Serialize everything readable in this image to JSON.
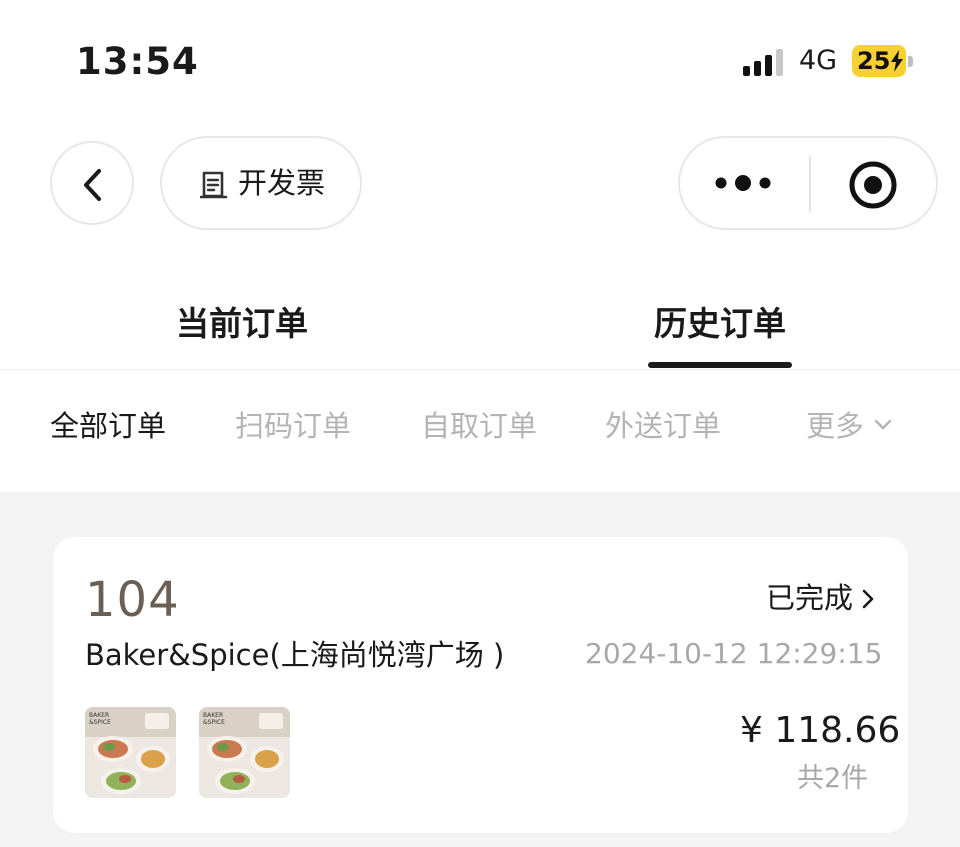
{
  "status_bar": {
    "time": "13:54",
    "network": "4G",
    "battery": "25",
    "battery_color": "#f8d032"
  },
  "nav": {
    "invoice_label": "开发票"
  },
  "tabs": {
    "current": "当前订单",
    "history": "历史订单",
    "active": "history"
  },
  "filters": {
    "items": [
      "全部订单",
      "扫码订单",
      "自取订单",
      "外送订单"
    ],
    "more": "更多",
    "active": "全部订单"
  },
  "orders": [
    {
      "number": "104",
      "status": "已完成",
      "store": "Baker&Spice(上海尚悦湾广场 )",
      "datetime": "2024-10-12 12:29:15",
      "price": "¥ 118.66",
      "count": "共2件",
      "thumb_brand": "BAKER & SPICE"
    }
  ],
  "colors": {
    "accent_order_number": "#6b5f55",
    "muted_text": "#a8a8a8",
    "page_bg": "#f3f3f3"
  }
}
